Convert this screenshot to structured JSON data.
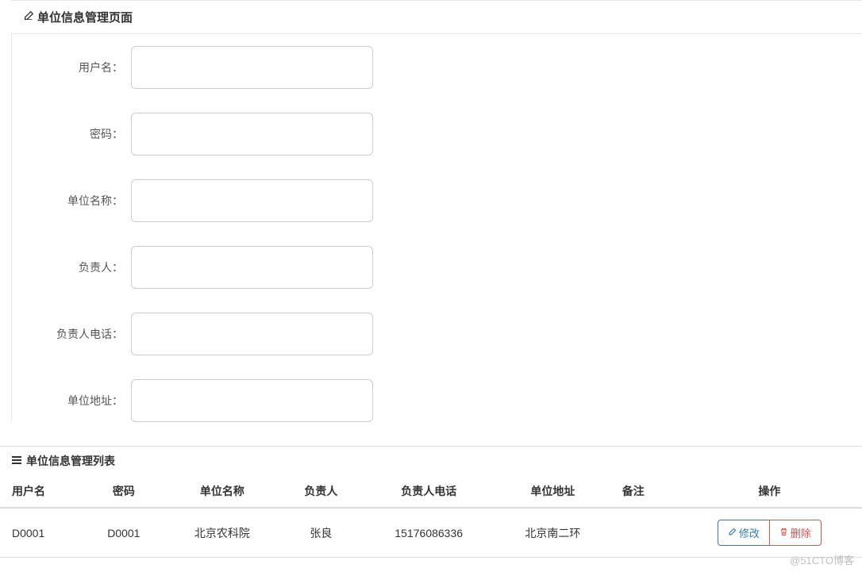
{
  "panel": {
    "title": "单位信息管理页面",
    "fields": {
      "username": {
        "label": "用户名：",
        "value": ""
      },
      "password": {
        "label": "密码：",
        "value": ""
      },
      "orgName": {
        "label": "单位名称：",
        "value": ""
      },
      "leader": {
        "label": "负责人：",
        "value": ""
      },
      "leaderPhone": {
        "label": "负责人电话：",
        "value": ""
      },
      "address": {
        "label": "单位地址：",
        "value": ""
      }
    }
  },
  "list": {
    "title": "单位信息管理列表",
    "headers": {
      "username": "用户名",
      "password": "密码",
      "orgName": "单位名称",
      "leader": "负责人",
      "leaderPhone": "负责人电话",
      "address": "单位地址",
      "remark": "备注",
      "action": "操作"
    },
    "rows": [
      {
        "username": "D0001",
        "password": "D0001",
        "orgName": "北京农科院",
        "leader": "张良",
        "leaderPhone": "15176086336",
        "address": "北京南二环",
        "remark": ""
      }
    ],
    "actions": {
      "edit": "修改",
      "delete": "删除"
    }
  },
  "watermark": "@51CTO博客"
}
